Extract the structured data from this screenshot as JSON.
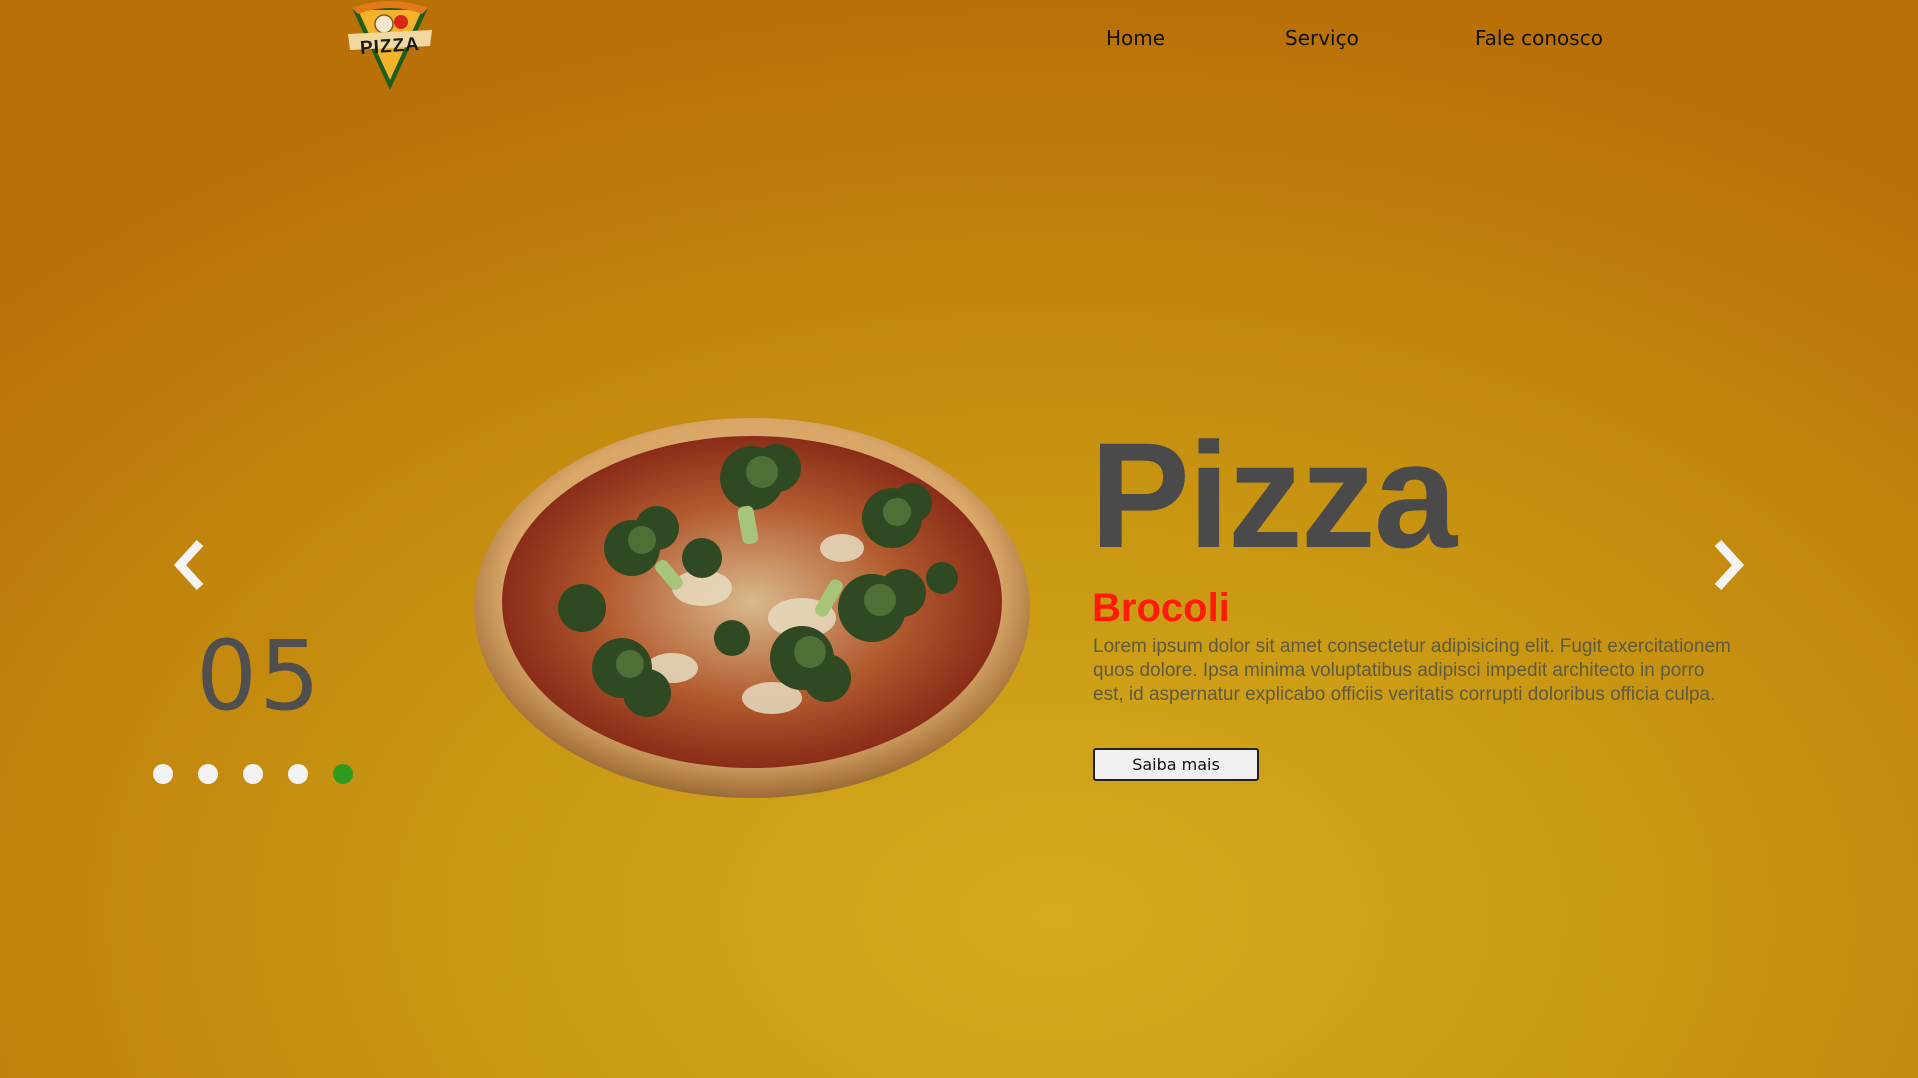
{
  "header": {
    "logo_text": "PIZZA",
    "nav": [
      {
        "label": "Home"
      },
      {
        "label": "Serviço"
      },
      {
        "label": "Fale conosco"
      }
    ]
  },
  "slider": {
    "counter": "05",
    "dots_total": 5,
    "active_dot": 5,
    "prev_icon": "chevron-left-icon",
    "next_icon": "chevron-right-icon"
  },
  "product": {
    "title": "Pizza",
    "name": "Brocoli",
    "description": "Lorem ipsum dolor sit amet consectetur adipisicing elit. Fugit exercitationem quos dolore. Ipsa minima voluptatibus adipisci impedit architecto in porro est, id aspernatur explicabo officiis veritatis corrupti doloribus officia culpa.",
    "button_label": "Saiba mais",
    "image": "broccoli-pizza-image"
  },
  "colors": {
    "title": "#4a4a4a",
    "name": "#ff1a0a",
    "active_dot": "#2e9a1e",
    "inactive_dot": "#f2f2f2"
  }
}
